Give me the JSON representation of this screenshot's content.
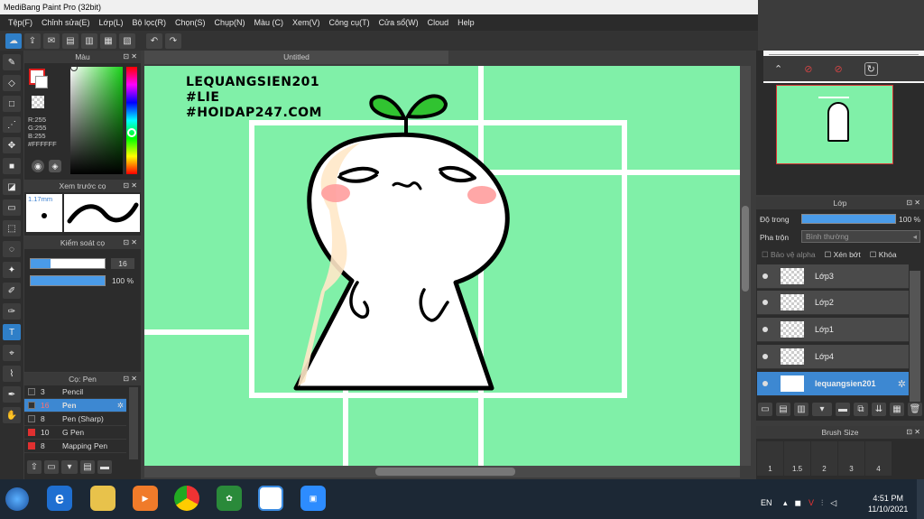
{
  "window": {
    "title": "MediBang Paint Pro (32bit)"
  },
  "menu": [
    "Tệp(F)",
    "Chỉnh sửa(E)",
    "Lớp(L)",
    "Bộ lọc(R)",
    "Chọn(S)",
    "Chụp(N)",
    "Màu (C)",
    "Xem(V)",
    "Công cụ(T)",
    "Cửa sổ(W)",
    "Cloud",
    "Help"
  ],
  "color_panel": {
    "title": "Màu",
    "r": "R:255",
    "g": "G:255",
    "b": "B:255",
    "hex": "#FFFFFF"
  },
  "brush_preview": {
    "title": "Xem trước cọ",
    "size": "1.17mm"
  },
  "brush_control": {
    "title": "Kiểm soát cọ",
    "size_value": "16",
    "opacity_value": "100 %",
    "size_fraction": 0.27,
    "opacity_fraction": 1.0
  },
  "brush_list": {
    "title": "Cọ: Pen",
    "items": [
      {
        "size": "3",
        "name": "Pencil",
        "selected": false,
        "color": "#333333"
      },
      {
        "size": "16",
        "name": "Pen",
        "selected": true,
        "color": "#333333"
      },
      {
        "size": "8",
        "name": "Pen (Sharp)",
        "selected": false,
        "color": "#333333"
      },
      {
        "size": "10",
        "name": "G Pen",
        "selected": false,
        "color": "#e03030"
      },
      {
        "size": "8",
        "name": "Mapping Pen",
        "selected": false,
        "color": "#e03030"
      }
    ]
  },
  "document": {
    "tab": "Untitled"
  },
  "canvas_text": {
    "line1": "LEQUANGSIEN201",
    "line2": "#LIE",
    "line3": "#HOIDAP247.COM"
  },
  "layer_panel": {
    "title": "Lớp",
    "opacity_label": "Độ trong",
    "opacity_value": "100 %",
    "blend_label": "Pha trộn",
    "blend_value": "Bình thường",
    "protect_alpha": "Bảo vệ alpha",
    "clipping": "Xén bớt",
    "lock": "Khóa",
    "layers": [
      "Lớp3",
      "Lớp2",
      "Lớp1",
      "Lớp4",
      "lequangsien201"
    ]
  },
  "brush_size_panel": {
    "title": "Brush Size",
    "sizes": [
      "1",
      "1.5",
      "2",
      "3",
      "4"
    ]
  },
  "taskbar": {
    "lang": "EN",
    "time": "4:51 PM",
    "date": "11/10/2021"
  },
  "colors": {
    "canvas_bg": "#80f0a8",
    "accent": "#3d88d2"
  }
}
